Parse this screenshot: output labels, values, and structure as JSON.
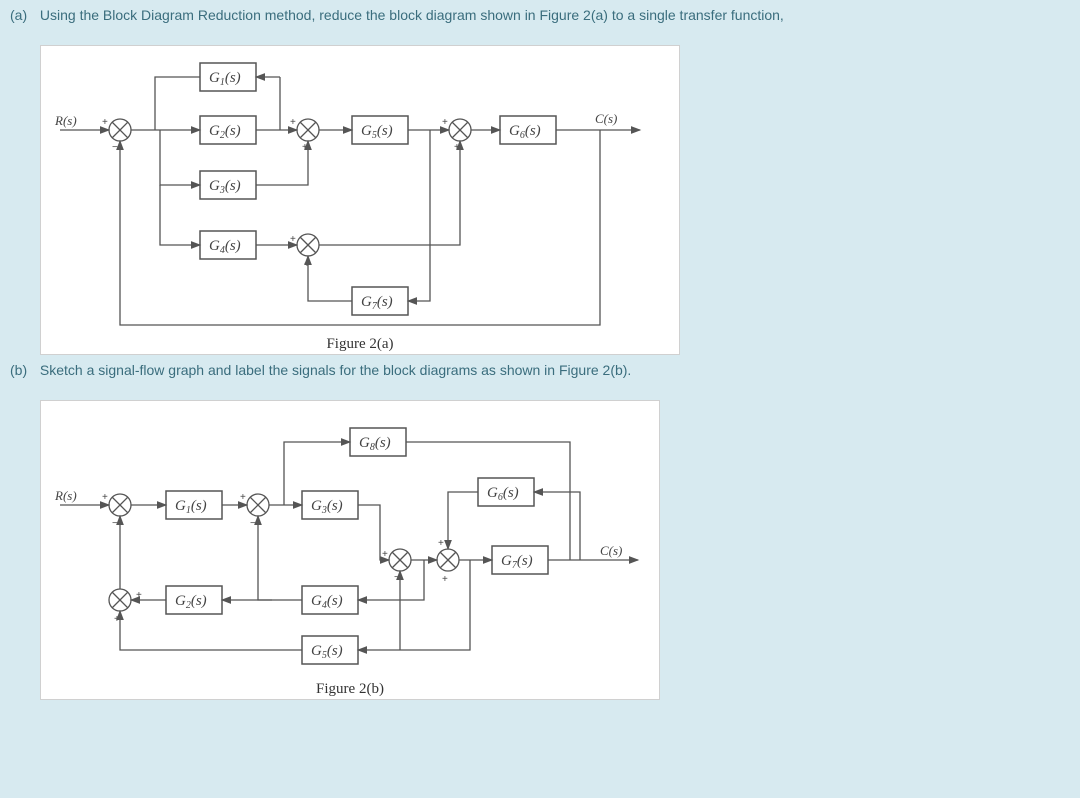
{
  "question_a": {
    "label": "(a)",
    "text": "Using the Block Diagram Reduction method, reduce the block diagram shown in Figure 2(a) to a single transfer function,"
  },
  "question_b": {
    "label": "(b)",
    "text": "Sketch a signal-flow graph and label the signals for the block diagrams as shown in Figure 2(b)."
  },
  "fig_a": {
    "caption": "Figure 2(a)",
    "input": "R(s)",
    "output": "C(s)",
    "blocks": {
      "G1": "G₁(s)",
      "G2": "G₂(s)",
      "G3": "G₃(s)",
      "G4": "G₄(s)",
      "G5": "G₅(s)",
      "G6": "G₆(s)",
      "G7": "G₇(s)"
    },
    "sums": [
      "S1",
      "S2",
      "S3",
      "S4"
    ]
  },
  "fig_b": {
    "caption": "Figure 2(b)",
    "input": "R(s)",
    "output": "C(s)",
    "blocks": {
      "G1": "G₁(s)",
      "G2": "G₂(s)",
      "G3": "G₃(s)",
      "G4": "G₄(s)",
      "G5": "G₅(s)",
      "G6": "G₆(s)",
      "G7": "G₇(s)",
      "G8": "G₈(s)"
    },
    "sums": [
      "S1",
      "S2",
      "S3",
      "S4",
      "S5"
    ]
  },
  "diagram_semantics": {
    "figure_2a": {
      "forward_path": [
        "R(s)",
        "S1",
        "G2",
        "S2",
        "G5",
        "S3",
        "G6",
        "C(s)"
      ],
      "feedback_blocks": [
        "G1 (from forward path back to S1)",
        "G3 (parallel path into S2)",
        "G4 (into S4 on lower path)",
        "G7 (feedback from before G6 back into S4/S1)"
      ]
    },
    "figure_2b": {
      "forward_path": [
        "R(s)",
        "S1",
        "G1",
        "S2",
        "G3",
        "S3",
        "S4",
        "G7",
        "C(s)"
      ],
      "feedback_blocks": [
        "G2 (lower feedback into S5 then S1)",
        "G4 (inner feedback)",
        "G5 (inner feedback)",
        "G6 (from after G7 back)",
        "G8 (feedforward from S2 to S4)"
      ]
    }
  }
}
